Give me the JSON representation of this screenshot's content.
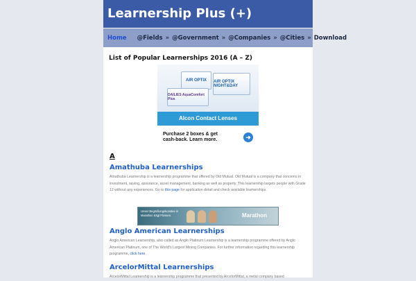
{
  "site": {
    "title": "Learnership Plus (+)"
  },
  "nav": {
    "items": [
      "Home",
      "@Fields",
      "»",
      "@Government",
      "»",
      "@Companies",
      "»",
      "@Cities",
      "»",
      "Download"
    ]
  },
  "main": {
    "list_title": "List of Popular Learnerships 2016 (A – Z)",
    "ad": {
      "product1": "AIR OPTIX",
      "product2": "AIR OPTIX NIGHT&DAY",
      "product3": "DAILIES AquaComfort Plus",
      "brand": "Alcon Contact Lenses",
      "offer_line1": "Purchase 2 boxes & get",
      "offer_line2": "cash-back. Learn more.",
      "arrow": "➜",
      "close": "▷✕"
    },
    "section_letter": "A",
    "entries": [
      {
        "heading": "Amathuba Learnerships",
        "text": "Amathuba Learnership is a learnership programme that offered by Old Mutual. Old Mutual is a company that concerns in investment, saving, assurance, asset management, banking as well as property. This learnership targets people with Grade 12 without any experiences. Go to ",
        "link": "this page",
        "text_after": " for application detail and check available learnerships."
      },
      {
        "heading": "Anglo American Learnerships",
        "text": "Anglo American Learnership, also called as Anglo Platinum Learnership is a learnership programme offered by Anglo American Platinum, one of The World's Largest Mining Companies. For further information regarding this learnership programme, ",
        "link": "click here",
        "text_after": "."
      },
      {
        "heading": "ArcelorMittal Learnerships",
        "text": "ArcelorMittal Learnership is a learnership programme that presented by ArcelorMittal, a metal company based",
        "link": "",
        "text_after": ""
      }
    ],
    "banner": {
      "left_text": "Unser Begrüßungskomitee in Marathon trägt Flossen.",
      "right_text": "Marathon"
    }
  },
  "colors": {
    "header_bg": "#3b5ba6",
    "nav_bg": "#8d9ec9",
    "link": "#1f5fc6",
    "ad_blue": "#2e9bd6"
  }
}
